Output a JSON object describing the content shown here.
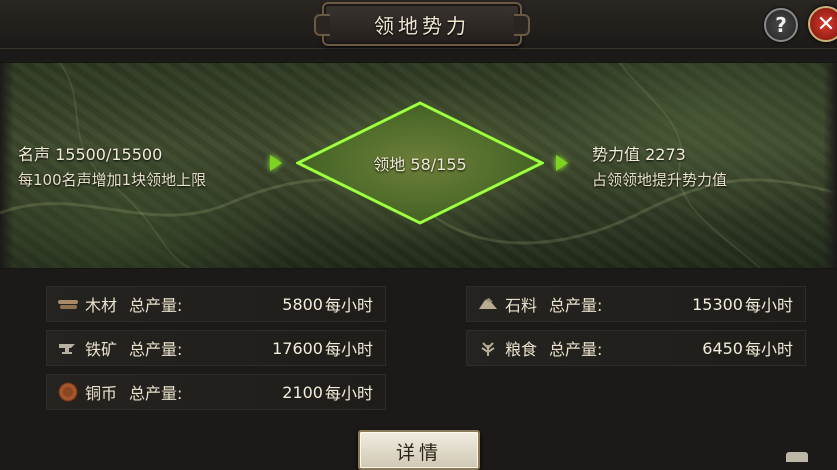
{
  "header": {
    "title": "领地势力",
    "help_label": "?",
    "close_label": "✕"
  },
  "map": {
    "fame": {
      "label": "名声 15500/15500",
      "desc": "每100名声增加1块领地上限"
    },
    "territory": {
      "label": "领地 58/155"
    },
    "power": {
      "label": "势力值 2273",
      "desc": "占领领地提升势力值"
    }
  },
  "resources": [
    {
      "name": "木材",
      "total_label": "总产量:",
      "value": "5800",
      "unit": "每小时",
      "icon": "wood-icon"
    },
    {
      "name": "石料",
      "total_label": "总产量:",
      "value": "15300",
      "unit": "每小时",
      "icon": "stone-icon"
    },
    {
      "name": "铁矿",
      "total_label": "总产量:",
      "value": "17600",
      "unit": "每小时",
      "icon": "iron-icon"
    },
    {
      "name": "粮食",
      "total_label": "总产量:",
      "value": "6450",
      "unit": "每小时",
      "icon": "grain-icon"
    },
    {
      "name": "铜币",
      "total_label": "总产量:",
      "value": "2100",
      "unit": "每小时",
      "icon": "copper-coin-icon"
    }
  ],
  "footer": {
    "detail_label": "详情"
  },
  "colors": {
    "accent_green": "#7ed321",
    "close_red": "#d83a2c"
  }
}
